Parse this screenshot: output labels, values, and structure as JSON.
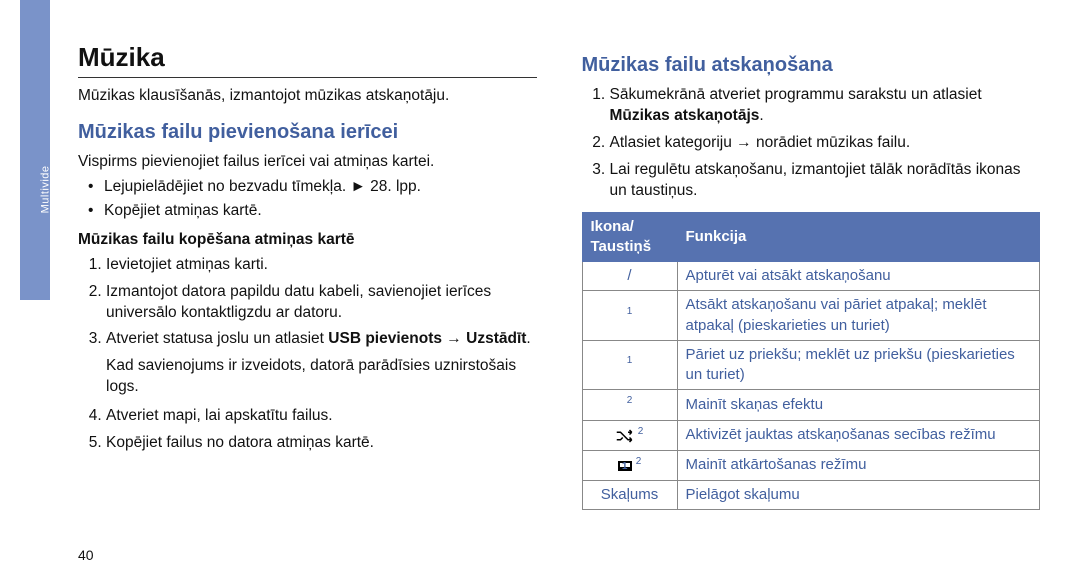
{
  "sideTab": "Multivide",
  "pageNumber": "40",
  "left": {
    "heading": "Mūzika",
    "intro": "Mūzikas klausīšanās, izmantojot mūzikas atskaņotāju.",
    "section1": {
      "title": "Mūzikas failu pievienošana ierīcei",
      "lead": "Vispirms pievienojiet failus ierīcei vai atmiņas kartei.",
      "b1": "Lejupielādējiet no bezvadu tīmekļa. ► 28. lpp.",
      "b2": "Kopējiet atmiņas kartē.",
      "subheading": "Mūzikas failu kopēšana atmiņas kartē",
      "s1": "Ievietojiet atmiņas karti.",
      "s2": "Izmantojot datora papildu datu kabeli, savienojiet ierīces universālo kontaktligzdu ar datoru.",
      "s3a": "Atveriet statusa joslu un atlasiet ",
      "s3b": "USB pievienots",
      "s3c": " → ",
      "s3d": "Uzstādīt",
      "s3e": ".",
      "s3note": "Kad savienojums ir izveidots, datorā parādīsies uznirstošais logs.",
      "s4": "Atveriet mapi, lai apskatītu failus.",
      "s5": "Kopējiet failus no datora atmiņas kartē."
    }
  },
  "right": {
    "section": {
      "title": "Mūzikas failu atskaņošana",
      "s1a": "Sākumekrānā atveriet programmu sarakstu un atlasiet ",
      "s1b": "Mūzikas atskaņotājs",
      "s1c": ".",
      "s2": "Atlasiet kategoriju → norādiet mūzikas failu.",
      "s3": "Lai regulētu atskaņošanu, izmantojiet tālāk norādītās ikonas un taustiņus."
    },
    "table": {
      "h1a": "Ikona/",
      "h1b": "Taustiņš",
      "h2": "Funkcija",
      "r1": "Apturēt vai atsākt atskaņošanu",
      "r2": "Atsākt atskaņošanu vai pāriet atpakaļ; meklēt atpakaļ (pieskarieties un turiet)",
      "r3": "Pāriet uz priekšu; meklēt uz priekšu (pieskarieties un turiet)",
      "r4": "Mainīt skaņas efektu",
      "r5": "Aktivizēt jauktas atskaņošanas secības režīmu",
      "r6": "Mainīt atkārtošanas režīmu",
      "r7k": "Skaļums",
      "r7": "Pielāgot skaļumu"
    }
  }
}
